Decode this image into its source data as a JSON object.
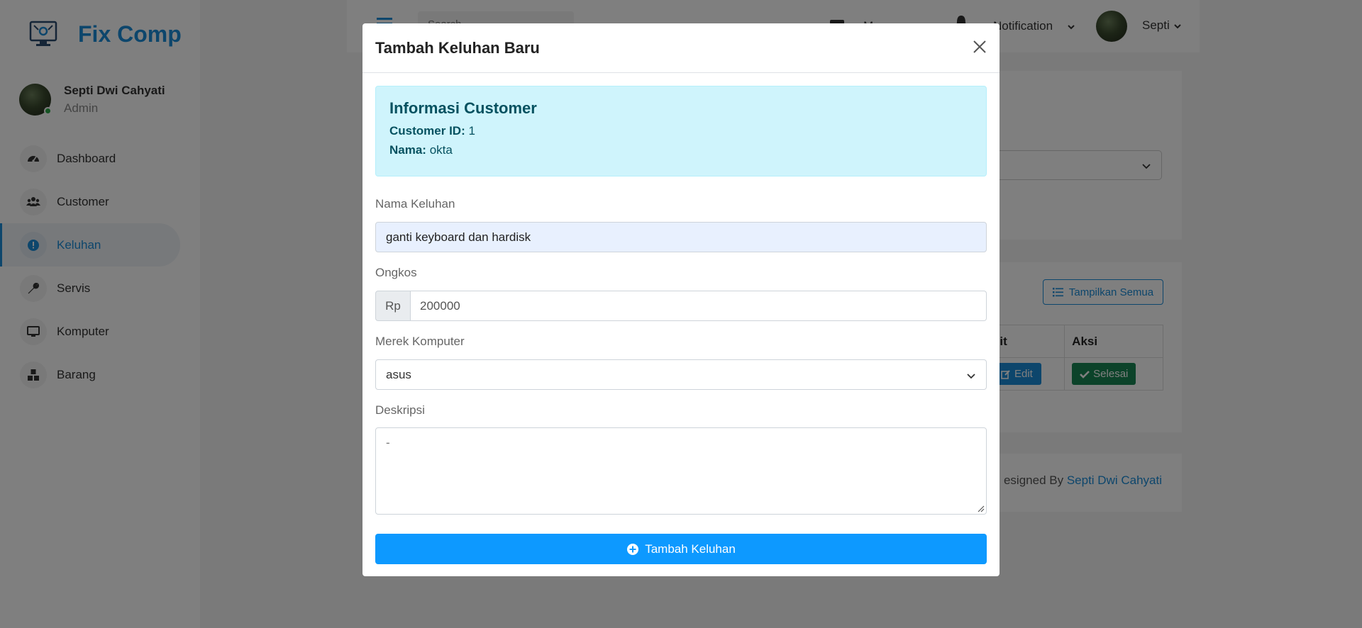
{
  "brand": {
    "name": "Fix Comp",
    "logo_icon": "computer-settings-icon"
  },
  "profile": {
    "name": "Septi Dwi Cahyati",
    "role": "Admin"
  },
  "sidebar": {
    "items": [
      {
        "label": "Dashboard",
        "icon": "gauge-icon"
      },
      {
        "label": "Customer",
        "icon": "users-icon"
      },
      {
        "label": "Keluhan",
        "icon": "exclamation-circle-icon",
        "active": true
      },
      {
        "label": "Servis",
        "icon": "wrench-icon"
      },
      {
        "label": "Komputer",
        "icon": "monitor-icon"
      },
      {
        "label": "Barang",
        "icon": "boxes-icon"
      }
    ]
  },
  "topbar": {
    "search_placeholder": "Search",
    "messages_label": "M",
    "notification_label": "Notification",
    "user_label": "Septi"
  },
  "background": {
    "show_all_label": "Tampilkan Semua",
    "table_headers": [
      "dit",
      "Aksi"
    ],
    "edit_label": "Edit",
    "done_label": "Selesai",
    "footer_prefix": "esigned By",
    "footer_author": "Septi Dwi Cahyati"
  },
  "modal": {
    "title": "Tambah Keluhan Baru",
    "info": {
      "title": "Informasi Customer",
      "customer_id_label": "Customer ID:",
      "customer_id_value": "1",
      "name_label": "Nama:",
      "name_value": "okta"
    },
    "fields": {
      "nama_keluhan_label": "Nama Keluhan",
      "nama_keluhan_value": "ganti keyboard dan hardisk",
      "ongkos_label": "Ongkos",
      "ongkos_prefix": "Rp",
      "ongkos_value": "200000",
      "merek_label": "Merek Komputer",
      "merek_value": "asus",
      "deskripsi_label": "Deskripsi",
      "deskripsi_value": "-"
    },
    "submit_label": "Tambah Keluhan"
  },
  "colors": {
    "accent": "#1a8cd8",
    "submit": "#0d99ff",
    "info_bg": "#cff4fc",
    "info_text": "#055160",
    "success": "#198754"
  }
}
